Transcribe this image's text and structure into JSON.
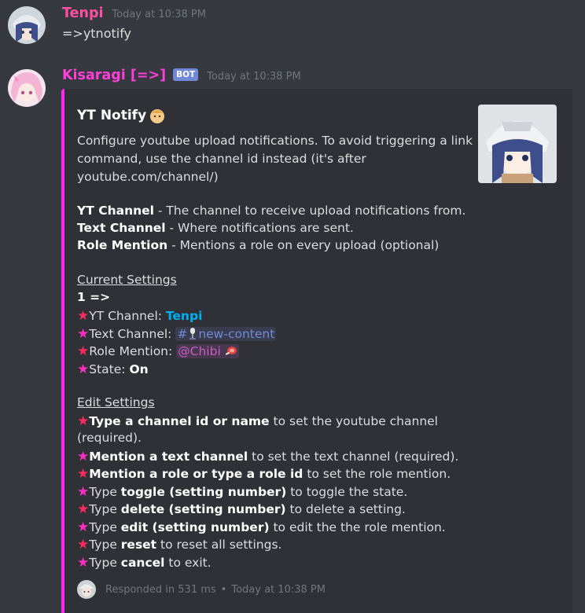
{
  "messages": [
    {
      "author": "Tenpi",
      "author_color": "#ff4fa0",
      "timestamp": "Today at 10:38 PM",
      "content": "=>ytnotify"
    },
    {
      "author": "Kisaragi [=>]",
      "author_color": "#ff3fd9",
      "bot_tag": "BOT",
      "timestamp": "Today at 10:38 PM"
    }
  ],
  "embed": {
    "accent_color": "#ff27f5",
    "title": "YT Notify",
    "desc_lines": [
      "Configure youtube upload notifications. To avoid triggering a link",
      "command, use the channel id instead (it's after",
      "youtube.com/channel/)"
    ],
    "fields": [
      {
        "name": "YT Channel",
        "text": " - The channel to receive upload notifications from."
      },
      {
        "name": "Text Channel",
        "text": " - Where notifications are sent."
      },
      {
        "name": "Role Mention",
        "text": " - Mentions a role on every upload (optional)"
      }
    ],
    "current_heading": "Current Settings",
    "setting_number": "1 =>",
    "settings": {
      "yt_label": "YT Channel: ",
      "yt_value": "Tenpi",
      "text_label": "Text Channel: ",
      "text_value": "new-content",
      "text_prefix": "#",
      "role_label": "Role Mention: ",
      "role_value": "@Chibi",
      "state_label": "State: ",
      "state_value": "On"
    },
    "edit_heading": "Edit Settings",
    "edit_lines": [
      {
        "pre": "",
        "bold": "Type a channel id or name",
        "post": " to set the youtube channel"
      },
      {
        "pre": "",
        "bold": "",
        "post": "(required)."
      },
      {
        "pre": "",
        "bold": "Mention a text channel",
        "post": " to set the text channel (required)."
      },
      {
        "pre": "",
        "bold": "Mention a role or type a role id",
        "post": " to set the role mention."
      },
      {
        "pre": "Type ",
        "bold": "toggle (setting number)",
        "post": " to toggle the state."
      },
      {
        "pre": "Type ",
        "bold": "delete (setting number)",
        "post": " to delete a setting."
      },
      {
        "pre": "Type ",
        "bold": "edit (setting number)",
        "post": " to edit the the role mention."
      },
      {
        "pre": "Type ",
        "bold": "reset",
        "post": " to reset all settings."
      },
      {
        "pre": "Type ",
        "bold": "cancel",
        "post": " to exit."
      }
    ],
    "footer_text": "Responded in 531 ms",
    "footer_sep": "•",
    "footer_time": "Today at 10:38 PM"
  },
  "icons": {
    "star": "★",
    "emoji_title": "girl-face-emoji",
    "emoji_channel": "microphone-emoji",
    "emoji_role": "meat-emoji"
  }
}
